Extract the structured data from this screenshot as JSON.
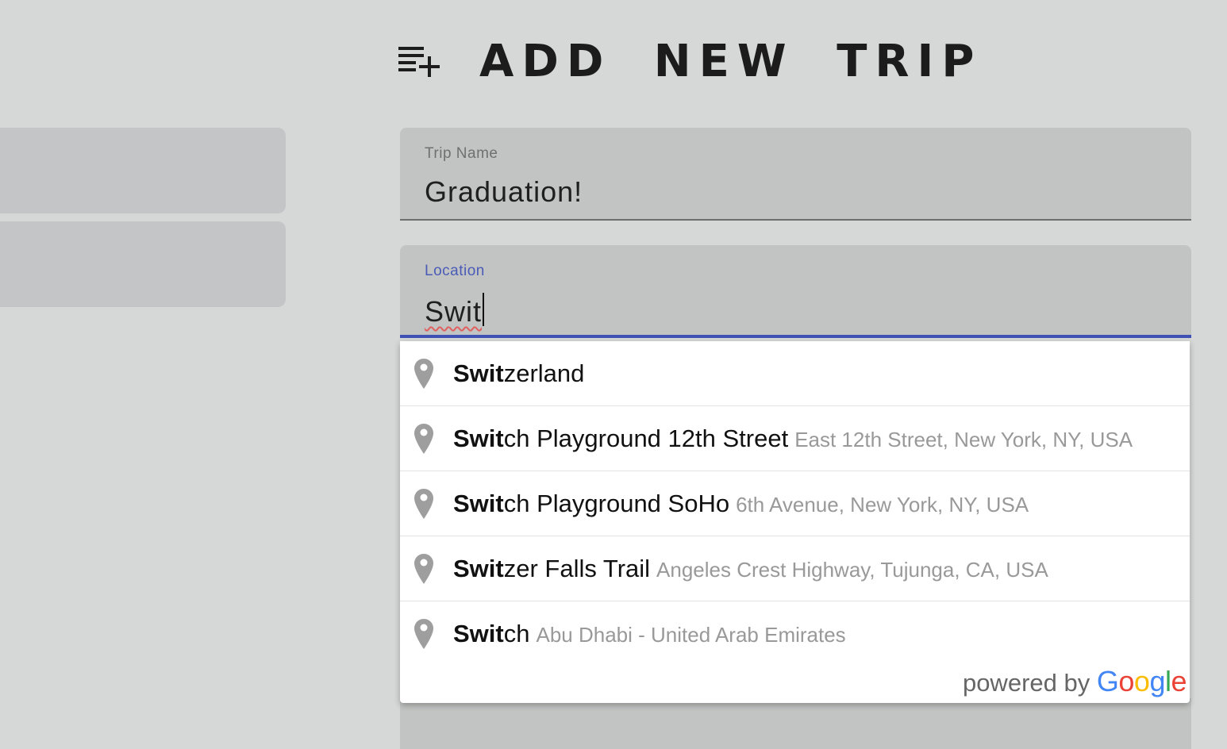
{
  "header": {
    "title": "ADD NEW TRIP",
    "icon": "playlist-add-icon"
  },
  "form": {
    "trip_name": {
      "label": "Trip Name",
      "value": "Graduation!"
    },
    "location": {
      "label": "Location",
      "value": "Swit"
    }
  },
  "autocomplete": {
    "suggestions": [
      {
        "match": "Swit",
        "rest": "zerland",
        "secondary": ""
      },
      {
        "match": "Swit",
        "rest": "ch Playground 12th Street",
        "secondary": "East 12th Street, New York, NY, USA"
      },
      {
        "match": "Swit",
        "rest": "ch Playground SoHo",
        "secondary": "6th Avenue, New York, NY, USA"
      },
      {
        "match": "Swit",
        "rest": "zer Falls Trail",
        "secondary": "Angeles Crest Highway, Tujunga, CA, USA"
      },
      {
        "match": "Swit",
        "rest": "ch",
        "secondary": "Abu Dhabi - United Arab Emirates"
      }
    ],
    "attribution": {
      "prefix": "powered by",
      "brand_letters": [
        "G",
        "o",
        "o",
        "g",
        "l",
        "e"
      ]
    }
  },
  "colors": {
    "background": "#d6d8d8",
    "field_bg": "#c2c4c3",
    "focus_accent": "#3f51b5",
    "google_blue": "#4285f4",
    "google_red": "#ea4335",
    "google_yellow": "#fbbc05",
    "google_green": "#34a853"
  }
}
